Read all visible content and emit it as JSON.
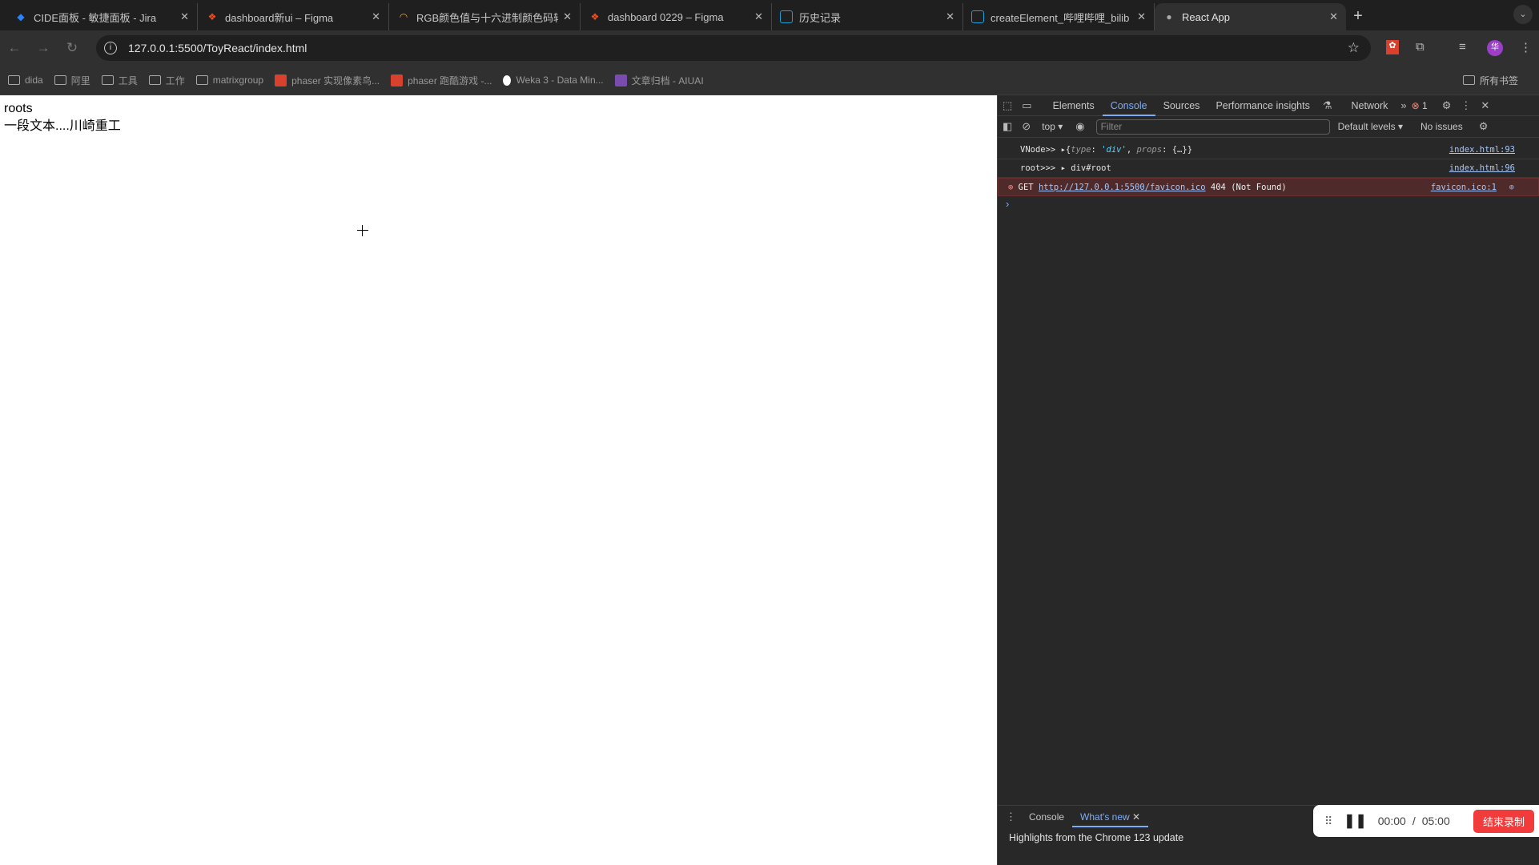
{
  "tabs": [
    {
      "title": "CIDE面板 - 敏捷面板 - Jira",
      "icon": "jira-icon"
    },
    {
      "title": "dashboard新ui – Figma",
      "icon": "figma-icon"
    },
    {
      "title": "RGB颜色值与十六进制颜色码转",
      "icon": "rainbow-icon"
    },
    {
      "title": "dashboard 0229 – Figma",
      "icon": "figma-icon"
    },
    {
      "title": "历史记录",
      "icon": "bilibili-icon"
    },
    {
      "title": "createElement_哔哩哔哩_bilib",
      "icon": "bilibili-icon"
    },
    {
      "title": "React App",
      "icon": "globe-icon",
      "active": true
    }
  ],
  "address": {
    "url": "127.0.0.1:5500/ToyReact/index.html"
  },
  "bookmarks": [
    "dida",
    "阿里",
    "工具",
    "工作",
    "matrixgroup",
    "phaser 实现像素鸟...",
    "phaser 跑酷游戏 -...",
    "Weka 3 - Data Min...",
    "文章归档 - AIUAI"
  ],
  "all_bookmarks": "所有书签",
  "page": {
    "line1": "roots",
    "line2": "一段文本....川崎重工"
  },
  "devtools": {
    "tabs": [
      "Elements",
      "Console",
      "Sources",
      "Performance insights",
      "Network"
    ],
    "active_tab": "Console",
    "error_count": "1",
    "context": "top",
    "filter_placeholder": "Filter",
    "levels": "Default levels",
    "issues": "No issues",
    "logs": [
      {
        "label": "VNode>>",
        "src": "index.html:93"
      },
      {
        "label": "root>>>",
        "value": "div#root",
        "src": "index.html:96"
      }
    ],
    "vnode": {
      "k1": "type",
      "v1": "'div'",
      "k2": "props",
      "v2": "{…}"
    },
    "error": {
      "method": "GET",
      "url": "http://127.0.0.1:5500/favicon.ico",
      "status": "404 (Not Found)",
      "src": "favicon.ico:1"
    },
    "drawer_tabs": [
      "Console",
      "What's new"
    ],
    "highlights": "Highlights from the Chrome 123 update"
  },
  "recorder": {
    "elapsed": "00:00",
    "sep": "/",
    "total": "05:00",
    "stop_label": "结束录制"
  },
  "colors": {
    "accent": "#7cacf8",
    "error_bg": "#4e2a2a",
    "record_red": "#f23c3c"
  }
}
